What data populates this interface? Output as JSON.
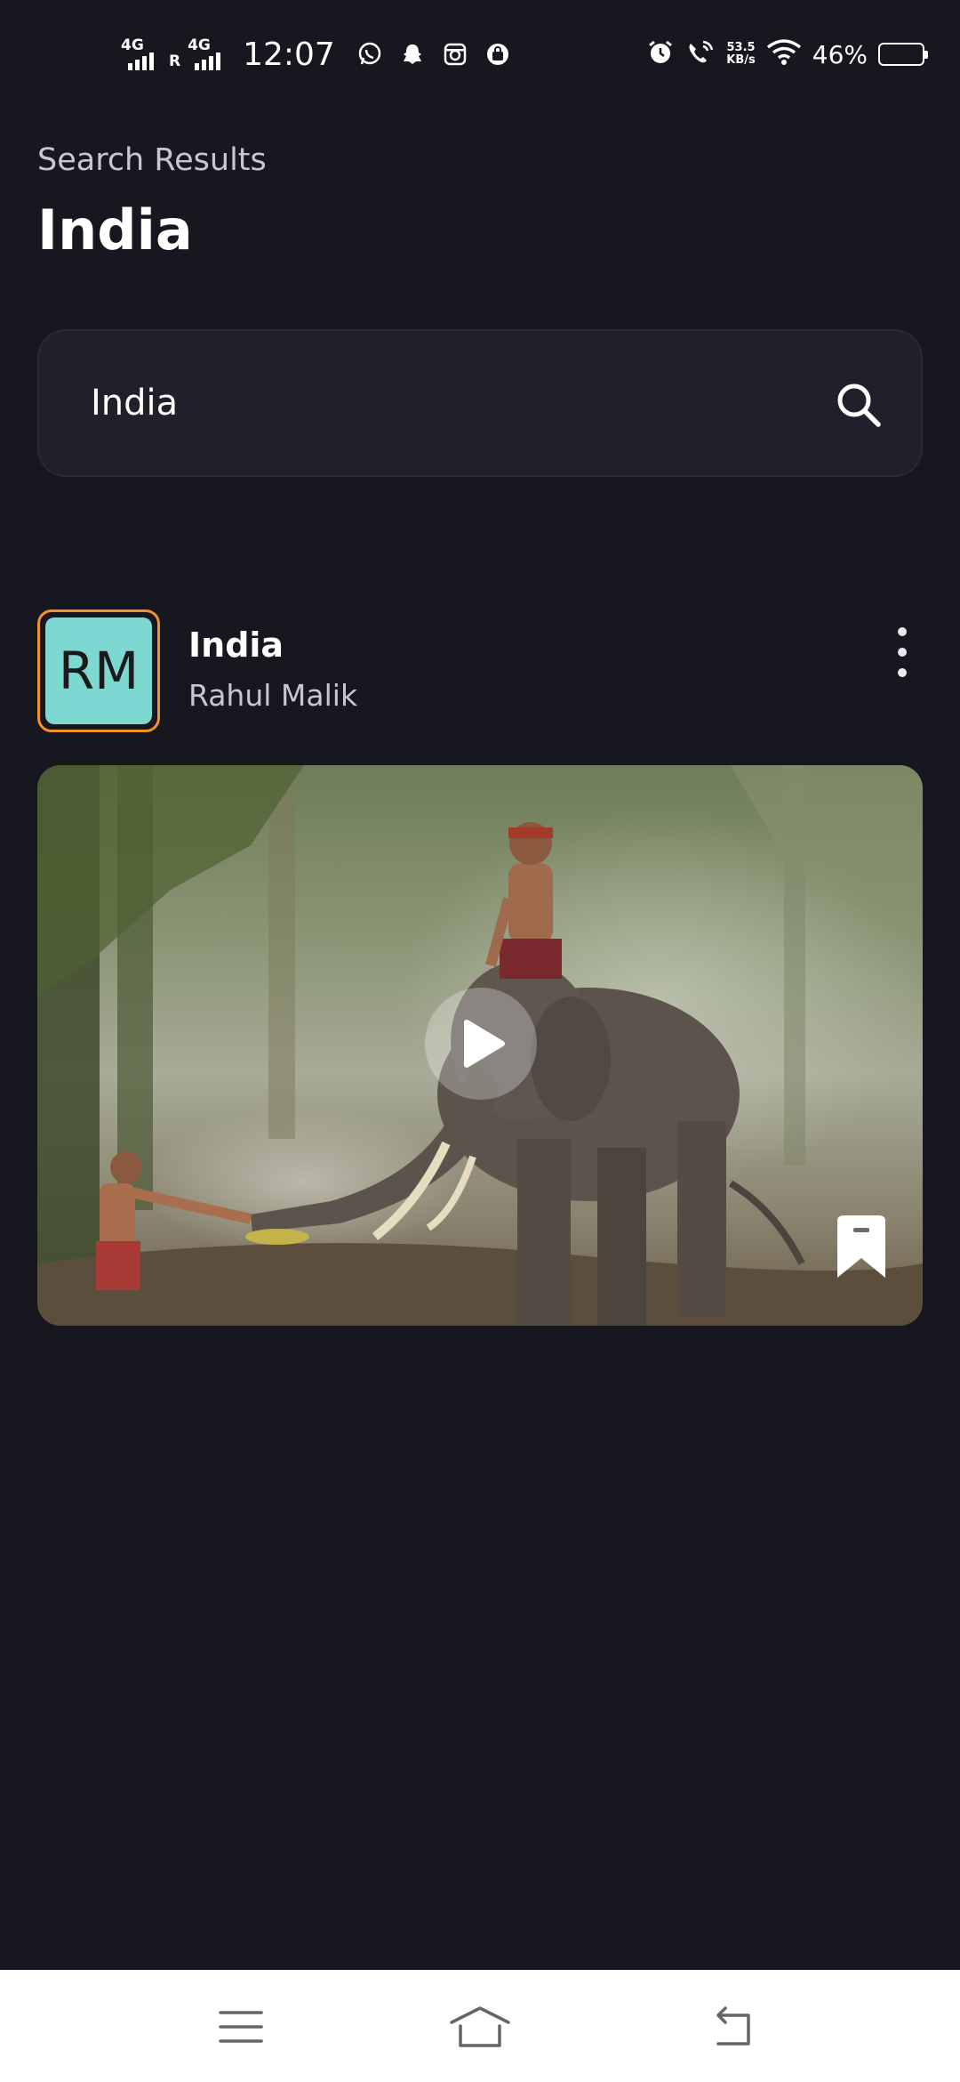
{
  "status_bar": {
    "network_1": "4G",
    "roaming": "R",
    "network_2": "4G",
    "time": "12:07",
    "notification_icons": [
      "whatsapp-icon",
      "snapchat-icon",
      "instagram-icon",
      "shopping-bag-icon"
    ],
    "net_speed_value": "53.5",
    "net_speed_unit": "KB/s",
    "battery_percent": "46%",
    "battery_level": 0.46
  },
  "header": {
    "subtitle": "Search Results",
    "title": "India"
  },
  "search": {
    "value": "India",
    "icon": "search-icon"
  },
  "result": {
    "avatar_initials": "RM",
    "title": "India",
    "author": "Rahul Malik",
    "colors": {
      "avatar_bg": "#7dd8d2",
      "avatar_border": "#f0932b"
    }
  },
  "nav": {
    "icons": [
      "menu-icon",
      "home-icon",
      "back-icon"
    ]
  },
  "theme": {
    "background": "#17171f",
    "surface": "#20202b",
    "muted_text": "#c8c6d6"
  }
}
